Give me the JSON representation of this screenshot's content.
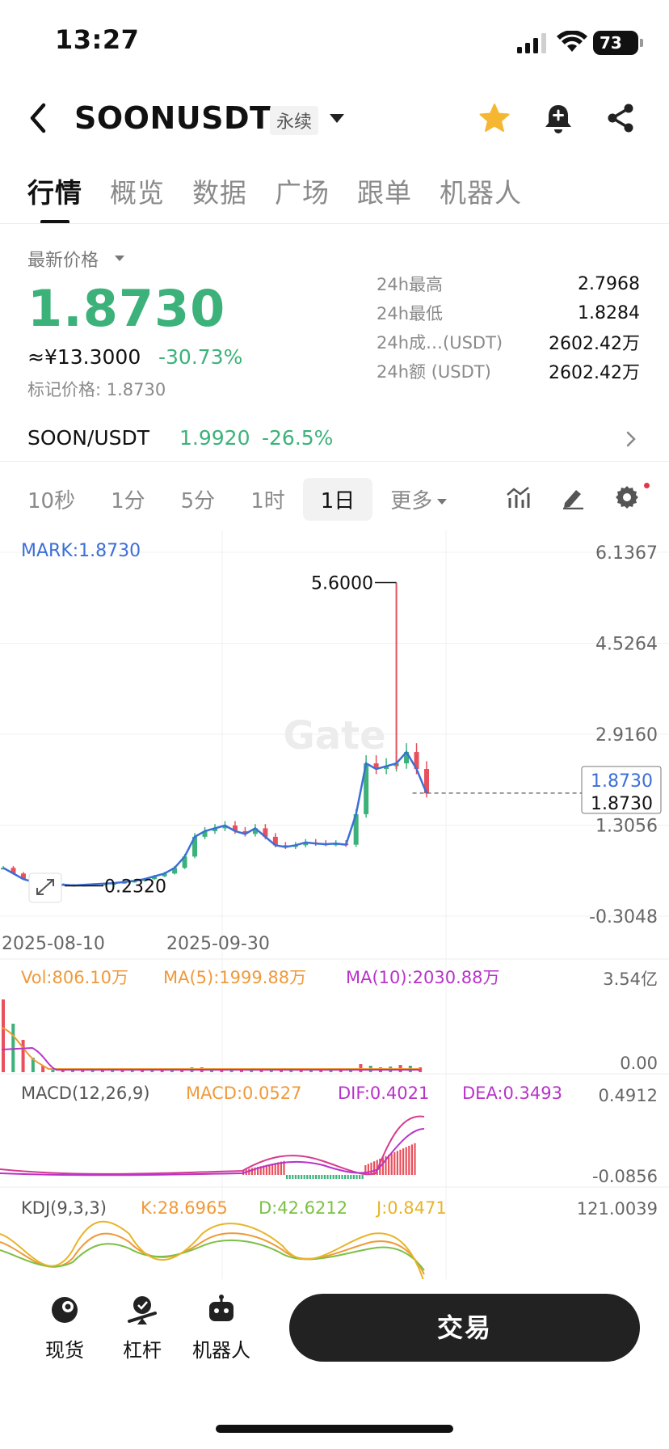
{
  "status_bar": {
    "time": "13:27",
    "battery": "73"
  },
  "header": {
    "symbol": "SOONUSDT",
    "contract_type": "永续"
  },
  "tabs": [
    {
      "label": "行情",
      "active": true
    },
    {
      "label": "概览"
    },
    {
      "label": "数据"
    },
    {
      "label": "广场"
    },
    {
      "label": "跟单"
    },
    {
      "label": "机器人"
    }
  ],
  "price": {
    "latest_label": "最新价格",
    "last": "1.8730",
    "cny": "≈¥13.3000",
    "change_pct": "-30.73%",
    "mark": "标记价格: 1.8730"
  },
  "stats": [
    {
      "label": "24h最高",
      "value": "2.7968"
    },
    {
      "label": "24h最低",
      "value": "1.8284"
    },
    {
      "label": "24h成…(USDT)",
      "value": "2602.42万"
    },
    {
      "label": "24h额 (USDT)",
      "value": "2602.42万"
    }
  ],
  "spot": {
    "pair": "SOON/USDT",
    "price": "1.9920",
    "change": "-26.5%"
  },
  "intervals": [
    {
      "label": "10秒"
    },
    {
      "label": "1分"
    },
    {
      "label": "5分"
    },
    {
      "label": "1时"
    },
    {
      "label": "1日",
      "active": true
    },
    {
      "label": "更多"
    }
  ],
  "chart_data": {
    "type": "candlestick",
    "watermark": "Gate",
    "mark_label": "MARK:1.8730",
    "y_ticks": [
      "6.1367",
      "4.5264",
      "2.9160",
      "1.3056",
      "-0.3048"
    ],
    "x_ticks": [
      "2025-08-10",
      "2025-09-30"
    ],
    "high_marker": "5.6000",
    "low_marker": "0.2320",
    "last_price_tags": [
      "1.8730",
      "1.8730"
    ],
    "price_series": [
      0.55,
      0.45,
      0.35,
      0.3,
      0.28,
      0.26,
      0.25,
      0.24,
      0.25,
      0.26,
      0.27,
      0.28,
      0.3,
      0.32,
      0.35,
      0.4,
      0.45,
      0.55,
      0.75,
      1.1,
      1.2,
      1.25,
      1.3,
      1.2,
      1.15,
      1.25,
      1.1,
      0.95,
      0.92,
      0.95,
      1.0,
      0.98,
      0.97,
      0.98,
      0.96,
      1.5,
      2.4,
      2.3,
      2.35,
      2.4,
      2.6,
      2.3,
      1.87
    ],
    "volume_panel": {
      "vol": "Vol:806.10万",
      "ma5": "MA(5):1999.88万",
      "ma10": "MA(10):2030.88万",
      "y_top": "3.54亿",
      "y_bottom": "0.00"
    },
    "macd_panel": {
      "title": "MACD(12,26,9)",
      "macd": "MACD:0.0527",
      "dif": "DIF:0.4021",
      "dea": "DEA:0.3493",
      "y_top": "0.4912",
      "y_bottom": "-0.0856"
    },
    "kdj_panel": {
      "title": "KDJ(9,3,3)",
      "k": "K:28.6965",
      "d": "D:42.6212",
      "j": "J:0.8471",
      "y_top": "121.0039"
    }
  },
  "bottom_nav": [
    {
      "label": "现货",
      "icon": "spot-icon"
    },
    {
      "label": "杠杆",
      "icon": "leverage-icon"
    },
    {
      "label": "机器人",
      "icon": "robot-icon"
    }
  ],
  "trade_button": "交易",
  "colors": {
    "up": "#3cb27a",
    "down": "#e8505b",
    "accent_blue": "#3b6fd8",
    "purple": "#b833c9",
    "orange": "#ef9a3a"
  }
}
